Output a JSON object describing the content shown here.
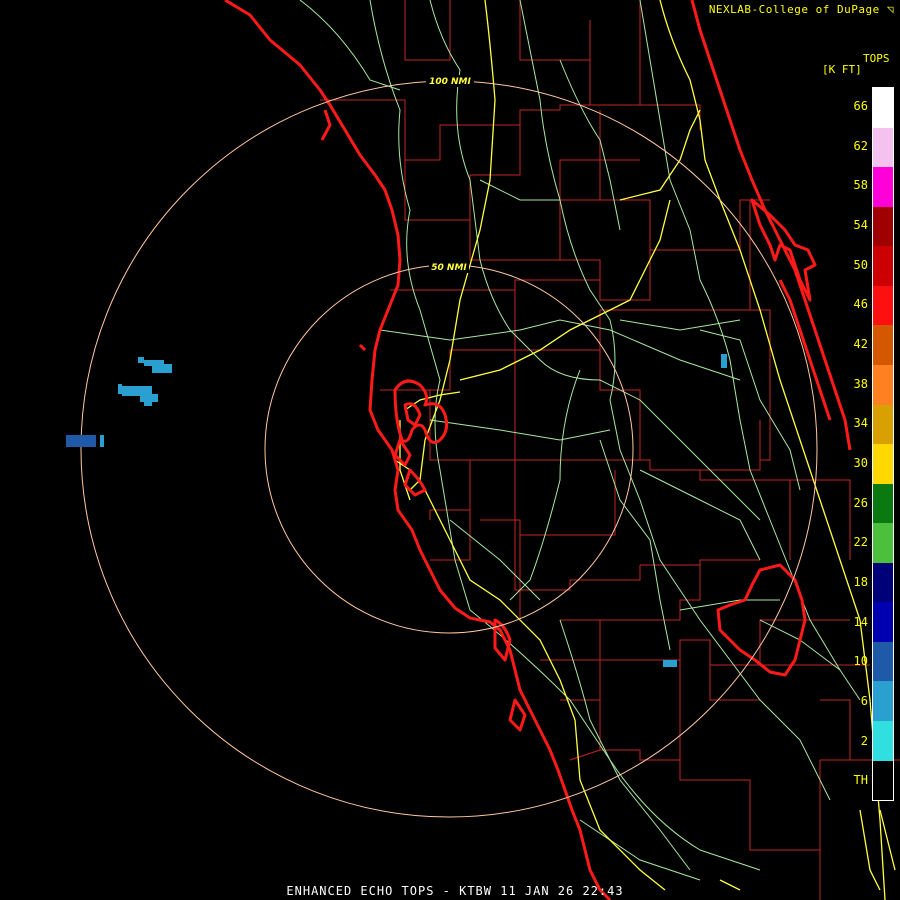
{
  "header": {
    "credit": "NEXLAB-College of DuPage ◹"
  },
  "legend": {
    "title": "TOPS",
    "units": "[K FT]",
    "labels": [
      "66",
      "62",
      "58",
      "54",
      "50",
      "46",
      "42",
      "38",
      "34",
      "30",
      "26",
      "22",
      "18",
      "14",
      "10",
      "6",
      "2",
      "TH"
    ],
    "colors": [
      "#ffffff",
      "#f5c2f0",
      "#ff00d8",
      "#a00000",
      "#cc0000",
      "#ff1010",
      "#d45800",
      "#ff8020",
      "#d8a000",
      "#ffd800",
      "#0a7a10",
      "#4cbf3c",
      "#000078",
      "#0000b0",
      "#1e5aa8",
      "#2aa0d0",
      "#30e0e0",
      "#000000"
    ]
  },
  "range_rings": [
    {
      "label": "100 NMI"
    },
    {
      "label": "50 NMI"
    }
  ],
  "footer": {
    "product": "ENHANCED ECHO TOPS - KTBW 11 JAN 26 22:43"
  },
  "colors": {
    "coast": "#ff1a1a",
    "county": "#c42424",
    "highway": "#ffff40",
    "road": "#a8e8a0",
    "ring": "#ffc8a0",
    "echo_light": "#2aa0d0",
    "echo_dark": "#1e5aa8"
  }
}
